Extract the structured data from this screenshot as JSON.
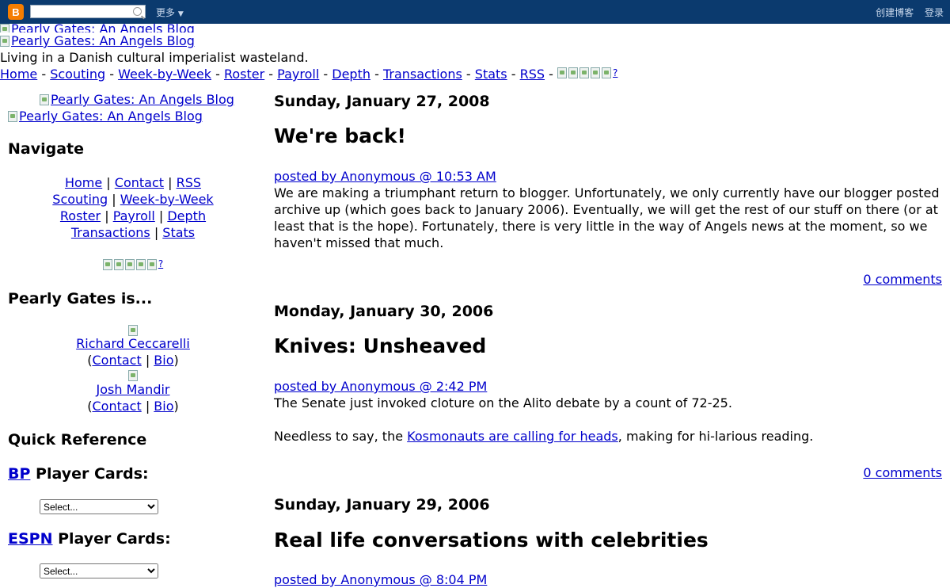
{
  "navbar": {
    "logo_letter": "B",
    "more": "更多",
    "create_blog": "创建博客",
    "login": "登录"
  },
  "header": {
    "image_alt_1": "Pearly Gates: An Angels Blog",
    "image_alt_2": "Pearly Gates: An Angels Blog",
    "tagline": "Living in a Danish cultural imperialist wasteland."
  },
  "topnav": {
    "links": [
      "Home",
      "Scouting",
      "Week-by-Week",
      "Roster",
      "Payroll",
      "Depth",
      "Transactions",
      "Stats",
      "RSS"
    ],
    "help": "?"
  },
  "sidebar": {
    "logo_alt_1": "Pearly Gates: An Angels Blog",
    "logo_alt_2": "Pearly Gates: An Angels Blog",
    "navigate_heading": "Navigate",
    "nav_links": {
      "home": "Home",
      "contact": "Contact",
      "rss": "RSS",
      "scouting": "Scouting",
      "week": "Week-by-Week",
      "roster": "Roster",
      "payroll": "Payroll",
      "depth": "Depth",
      "transactions": "Transactions",
      "stats": "Stats"
    },
    "help": "?",
    "pearly_heading": "Pearly Gates is...",
    "authors": [
      {
        "name": "Richard Ceccarelli",
        "contact": "Contact",
        "bio": "Bio"
      },
      {
        "name": "Josh Mandir",
        "contact": "Contact",
        "bio": "Bio"
      }
    ],
    "quick_ref_heading": "Quick Reference",
    "bp_link": "BP",
    "bp_rest": " Player Cards:",
    "espn_link": "ESPN",
    "espn_rest": " Player Cards:",
    "select_value": "Select..."
  },
  "posts": [
    {
      "date": "Sunday, January 27, 2008",
      "title": "We're back!",
      "byline": "posted by Anonymous @ 10:53 AM",
      "body": "We are making a triumphant return to blogger. Unfortunately, we only currently have our blogger posted archive up (which goes back to January 2006). Eventually, we will get the rest of our stuff on there (or at least that is the hope). Fortunately, there is very little in the way of Angels news at the moment, so we haven't missed that much.",
      "comments": "0 comments"
    },
    {
      "date": "Monday, January 30, 2006",
      "title": "Knives: Unsheaved",
      "byline": "posted by Anonymous @ 2:42 PM",
      "body1": "The Senate just invoked cloture on the Alito debate by a count of 72-25.",
      "body2_pre": "Needless to say, the ",
      "body2_link": "Kosmonauts are calling for heads",
      "body2_post": ", making for hi-larious reading.",
      "comments": "0 comments"
    },
    {
      "date": "Sunday, January 29, 2006",
      "title": "Real life conversations with celebrities",
      "byline": "posted by Anonymous @ 8:04 PM"
    }
  ]
}
